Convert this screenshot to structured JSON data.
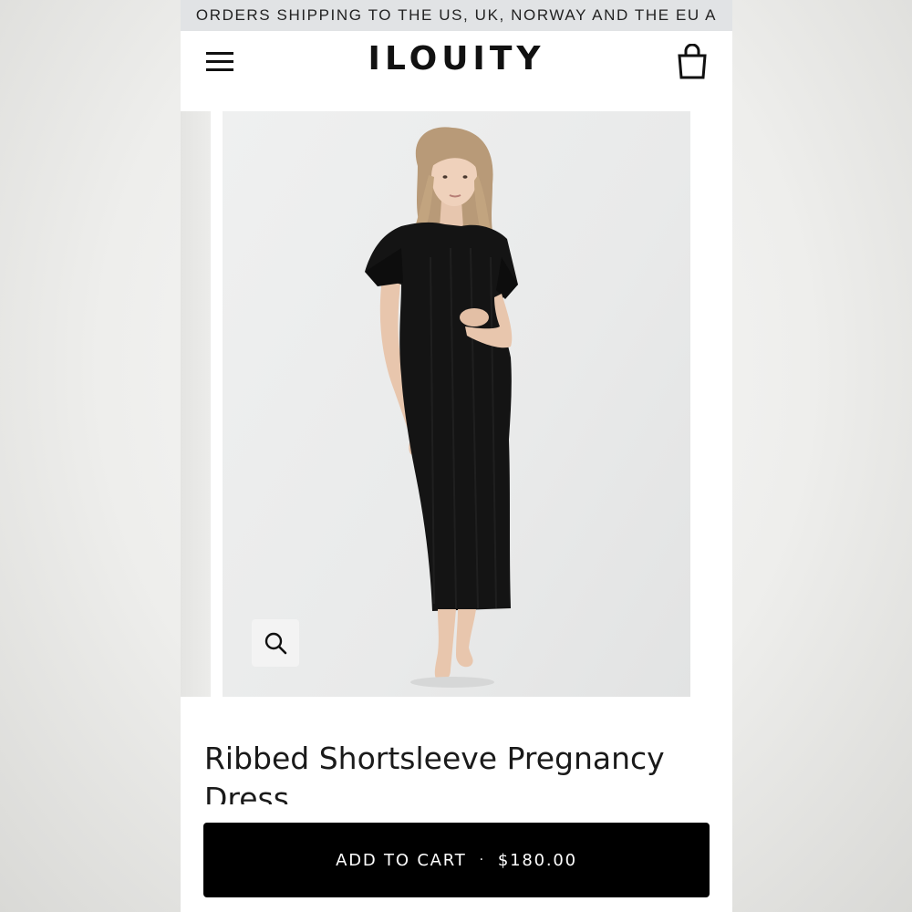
{
  "announcement": {
    "text": "ORDERS SHIPPING TO THE US, UK, NORWAY AND THE EU A"
  },
  "header": {
    "logo": "ILOUITY",
    "menu_icon": "hamburger-menu-icon",
    "cart_icon": "shopping-bag-icon"
  },
  "gallery": {
    "zoom_icon": "magnifier-icon",
    "image_alt": "Woman wearing black ribbed short-sleeve maternity dress"
  },
  "product": {
    "title": "Ribbed Shortsleeve Pregnancy Dress"
  },
  "cta": {
    "label": "ADD TO CART",
    "separator": "·",
    "price": "$180.00"
  },
  "colors": {
    "announcement_bg": "#e1e3e5",
    "button_bg": "#000000",
    "button_text": "#ffffff",
    "dress": "#141414"
  }
}
